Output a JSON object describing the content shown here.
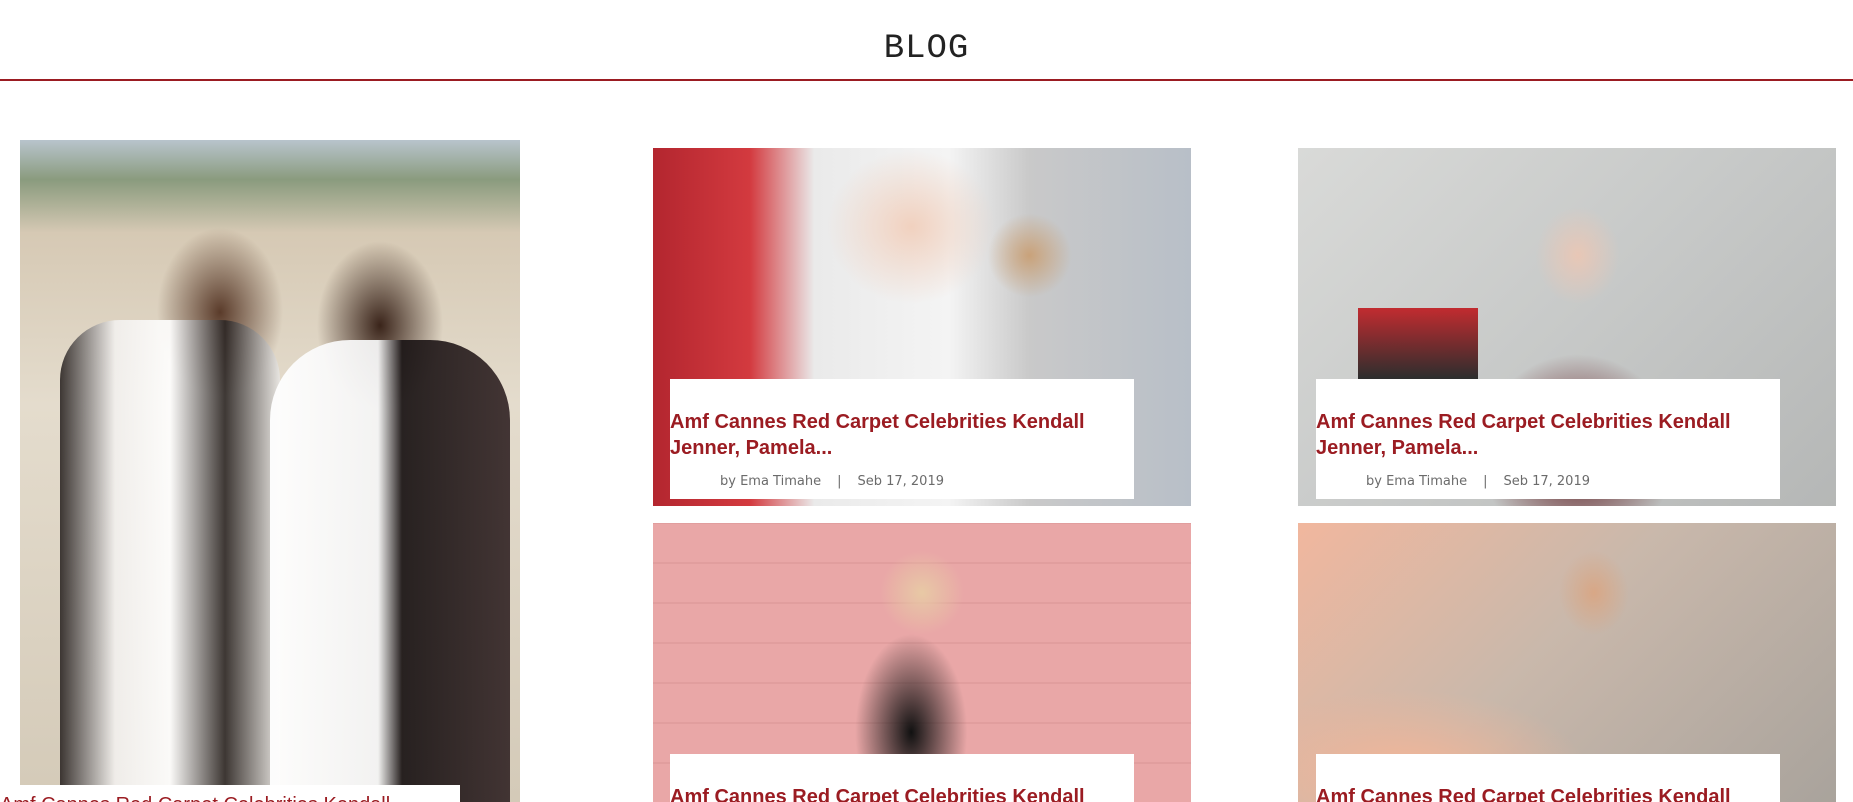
{
  "header": {
    "title": "BLOG"
  },
  "posts": [
    {
      "title": "Amf Cannes Red Carpet Celebrities Kendall"
    },
    {
      "title": "Amf Cannes Red Carpet Celebrities Kendall Jenner, Pamela...",
      "author": "by Ema Timahe",
      "separator": "|",
      "date": "Seb 17, 2019"
    },
    {
      "title": "Amf Cannes Red Carpet Celebrities Kendall Jenner, Pamela...",
      "author": "by Ema Timahe",
      "separator": "|",
      "date": "Seb 17, 2019"
    },
    {
      "title": "Amf Cannes Red Carpet Celebrities Kendall"
    },
    {
      "title": "Amf Cannes Red Carpet Celebrities Kendall"
    }
  ],
  "colors": {
    "accent": "#9b1c22",
    "meta_text": "#6b6b6b",
    "background": "#ffffff"
  }
}
